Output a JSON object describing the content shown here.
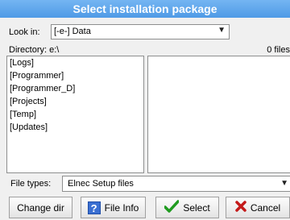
{
  "window": {
    "title": "Select installation package"
  },
  "look_in": {
    "label": "Look in:",
    "value": "[-e-]  Data",
    "icon": "chevron-down-icon"
  },
  "directory": {
    "label": "Directory: e:\\",
    "file_count": "0 files"
  },
  "dir_list": {
    "items": [
      "[Logs]",
      "[Programmer]",
      "[Programmer_D]",
      "[Projects]",
      "[Temp]",
      "[Updates]"
    ]
  },
  "file_types": {
    "label": "File types:",
    "value": "Elnec Setup files",
    "icon": "chevron-down-icon"
  },
  "buttons": {
    "change_dir": "Change dir",
    "file_info": "File Info",
    "select": "Select",
    "cancel": "Cancel"
  },
  "colors": {
    "title_bar": "#5ea5ec",
    "select_check": "#1f9b1f",
    "cancel_x": "#c41a1a"
  }
}
